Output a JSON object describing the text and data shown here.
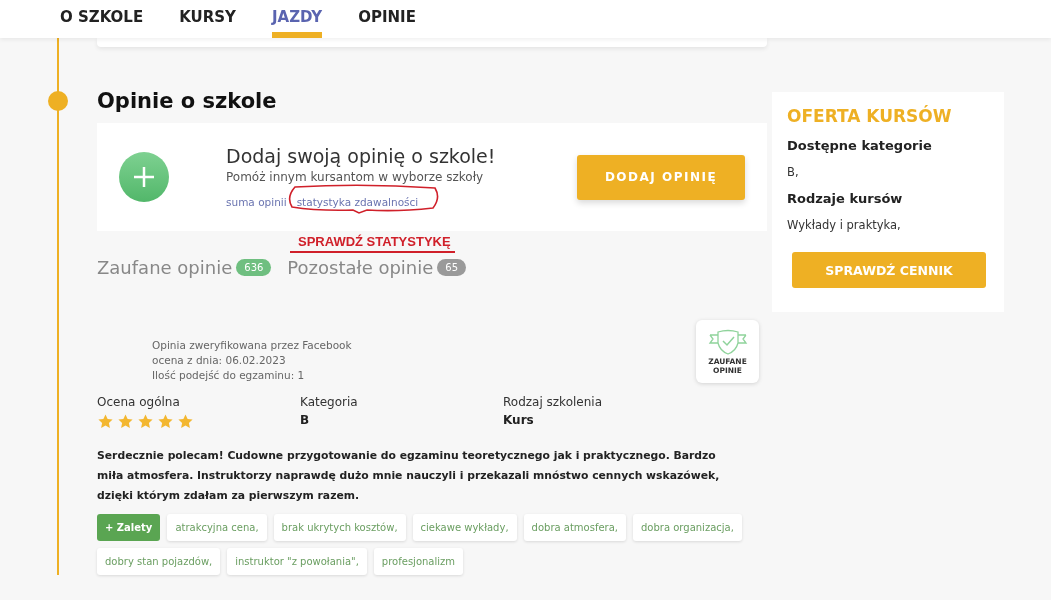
{
  "nav": {
    "tabs": [
      {
        "label": "O SZKOLE",
        "selected": false
      },
      {
        "label": "KURSY",
        "selected": false
      },
      {
        "label": "JAZDY",
        "selected": true
      },
      {
        "label": "OPINIE",
        "selected": false
      }
    ]
  },
  "section": {
    "title": "Opinie o szkole"
  },
  "add_review": {
    "title": "Dodaj swoją opinię o szkole!",
    "subtitle": "Pomóż innym kursantom w wyborze szkoły",
    "links": [
      "suma opinii",
      "statystyka zdawalności"
    ],
    "button": "DODAJ OPINIĘ"
  },
  "annotation": {
    "text": "SPRAWDŹ STATYSTYKĘ"
  },
  "review_tabs": [
    {
      "label": "Zaufane opinie",
      "count": "636",
      "color": "#6fbf80"
    },
    {
      "label": "Pozostałe opinie",
      "count": "65",
      "color": "#9a9a9a"
    }
  ],
  "review": {
    "meta": [
      "Opinia zweryfikowana przez Facebook",
      "ocena z dnia: 06.02.2023",
      "Ilość podejść do egzaminu: 1"
    ],
    "badge": [
      "ZAUFANE",
      "OPINIE"
    ],
    "fields": [
      {
        "label": "Ocena ogólna",
        "kind": "stars",
        "stars": 5
      },
      {
        "label": "Kategoria",
        "kind": "text",
        "value": "B"
      },
      {
        "label": "Rodzaj szkolenia",
        "kind": "text",
        "value": "Kurs"
      }
    ],
    "text": "Serdecznie polecam! Cudowne przygotowanie do egzaminu teoretycznego jak i praktycznego. Bardzo miła atmosfera. Instruktorzy naprawdę dużo mnie nauczyli i przekazali mnóstwo cennych wskazówek, dzięki którym zdałam za pierwszym razem.",
    "pros_label": "+ Zalety",
    "pros": [
      "atrakcyjna cena,",
      "brak ukrytych kosztów,",
      "ciekawe wykłady,",
      "dobra atmosfera,",
      "dobra organizacja,",
      "dobry stan pojazdów,",
      "instruktor \"z powołania\",",
      "profesjonalizm"
    ]
  },
  "sidebar": {
    "title": "OFERTA KURSÓW",
    "sections": [
      {
        "heading": "Dostępne kategorie",
        "value": "B,"
      },
      {
        "heading": "Rodzaje kursów",
        "value": "Wykłady i praktyka,"
      }
    ],
    "button": "SPRAWDŹ CENNIK"
  }
}
